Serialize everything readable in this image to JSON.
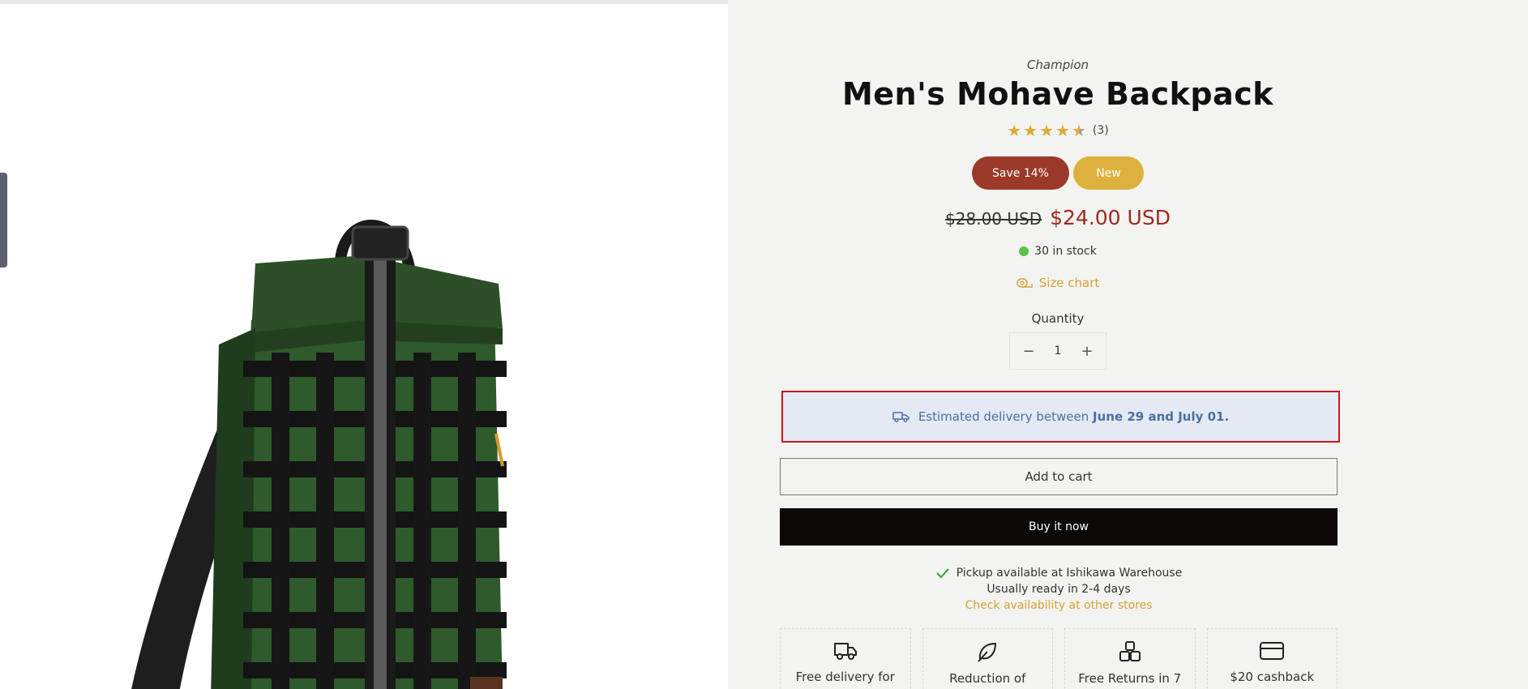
{
  "product": {
    "brand": "Champion",
    "title": "Men's Mohave Backpack",
    "rating": {
      "value": 4.5,
      "max": 5,
      "count_label": "(3)"
    },
    "badges": {
      "save": "Save 14%",
      "new": "New"
    },
    "compare_price": "$28.00 USD",
    "price": "$24.00 USD",
    "stock": "30 in stock",
    "size_chart": "Size chart"
  },
  "quantity": {
    "label": "Quantity",
    "value": "1",
    "minus": "−",
    "plus": "+"
  },
  "delivery": {
    "prefix": "Estimated delivery between",
    "dates": "June 29 and July 01."
  },
  "actions": {
    "add_to_cart": "Add to cart",
    "buy_now": "Buy it now"
  },
  "pickup": {
    "line": "Pickup available at Ishikawa Warehouse",
    "ready": "Usually ready in 2-4 days",
    "link": "Check availability at other stores"
  },
  "features": [
    {
      "icon": "truck-icon",
      "text": "Free delivery for"
    },
    {
      "icon": "leaf-icon",
      "text": "Reduction of"
    },
    {
      "icon": "boxes-icon",
      "text": "Free Returns in 7"
    },
    {
      "icon": "credit-card-icon",
      "text": "$20 cashback"
    }
  ],
  "colors": {
    "accent": "#d6a235",
    "sale_badge": "#9b3a2a",
    "new_badge": "#ddb13e",
    "price": "#9b2a1f",
    "stock_dot": "#5ec24a",
    "delivery_text": "#4a6fa4",
    "buy_now": "#0c0805"
  }
}
